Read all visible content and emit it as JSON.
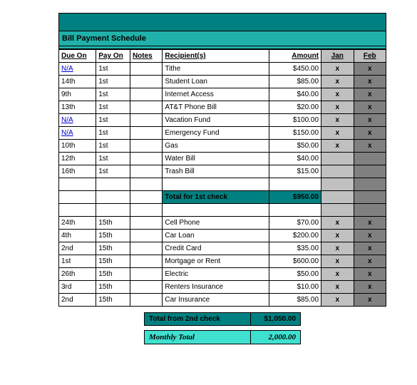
{
  "title": "Bill Payment Schedule",
  "headers": {
    "due": "Due On",
    "pay": "Pay On",
    "notes": "Notes",
    "recip": "Recipient(s)",
    "amount": "Amount",
    "jan": "Jan",
    "feb": "Feb"
  },
  "rows1": [
    {
      "due": "N/A",
      "due_link": true,
      "pay": "1st",
      "notes": "",
      "recip": "Tithe",
      "amt": "$450.00",
      "jan": "x",
      "feb": "x"
    },
    {
      "due": "14th",
      "due_link": false,
      "pay": "1st",
      "notes": "",
      "recip": "Student Loan",
      "amt": "$85.00",
      "jan": "x",
      "feb": "x"
    },
    {
      "due": "9th",
      "due_link": false,
      "pay": "1st",
      "notes": "",
      "recip": "Internet Access",
      "amt": "$40.00",
      "jan": "x",
      "feb": "x"
    },
    {
      "due": "13th",
      "due_link": false,
      "pay": "1st",
      "notes": "",
      "recip": "AT&T Phone Bill",
      "amt": "$20.00",
      "jan": "x",
      "feb": "x"
    },
    {
      "due": "N/A",
      "due_link": true,
      "pay": "1st",
      "notes": "",
      "recip": "Vacation Fund",
      "amt": "$100.00",
      "jan": "x",
      "feb": "x"
    },
    {
      "due": "N/A",
      "due_link": true,
      "pay": "1st",
      "notes": "",
      "recip": "Emergency Fund",
      "amt": "$150.00",
      "jan": "x",
      "feb": "x"
    },
    {
      "due": "10th",
      "due_link": false,
      "pay": "1st",
      "notes": "",
      "recip": "Gas",
      "amt": "$50.00",
      "jan": "x",
      "feb": "x"
    },
    {
      "due": "12th",
      "due_link": false,
      "pay": "1st",
      "notes": "",
      "recip": "Water Bill",
      "amt": "$40.00",
      "jan": "",
      "feb": ""
    },
    {
      "due": "16th",
      "due_link": false,
      "pay": "1st",
      "notes": "",
      "recip": "Trash Bill",
      "amt": "$15.00",
      "jan": "",
      "feb": ""
    }
  ],
  "subtotal1": {
    "label": "Total for 1st check",
    "value": "$950.00"
  },
  "rows2": [
    {
      "due": "24th",
      "pay": "15th",
      "notes": "",
      "recip": "Cell Phone",
      "amt": "$70.00",
      "jan": "x",
      "feb": "x"
    },
    {
      "due": "4th",
      "pay": "15th",
      "notes": "",
      "recip": "Car Loan",
      "amt": "$200.00",
      "jan": "x",
      "feb": "x"
    },
    {
      "due": "2nd",
      "pay": "15th",
      "notes": "",
      "recip": "Credit Card",
      "amt": "$35.00",
      "jan": "x",
      "feb": "x"
    },
    {
      "due": "1st",
      "pay": "15th",
      "notes": "",
      "recip": "Mortgage or Rent",
      "amt": "$600.00",
      "jan": "x",
      "feb": "x"
    },
    {
      "due": "26th",
      "pay": "15th",
      "notes": "",
      "recip": "Electric",
      "amt": "$50.00",
      "jan": "x",
      "feb": "x"
    },
    {
      "due": "3rd",
      "pay": "15th",
      "notes": "",
      "recip": "Renters Insurance",
      "amt": "$10.00",
      "jan": "x",
      "feb": "x"
    },
    {
      "due": "2nd",
      "pay": "15th",
      "notes": "",
      "recip": "Car Insurance",
      "amt": "$85.00",
      "jan": "x",
      "feb": "x"
    }
  ],
  "subtotal2": {
    "label": "Total from 2nd check",
    "value": "$1,050.00"
  },
  "grand": {
    "label": "Monthly Total",
    "value": "2,000.00"
  }
}
